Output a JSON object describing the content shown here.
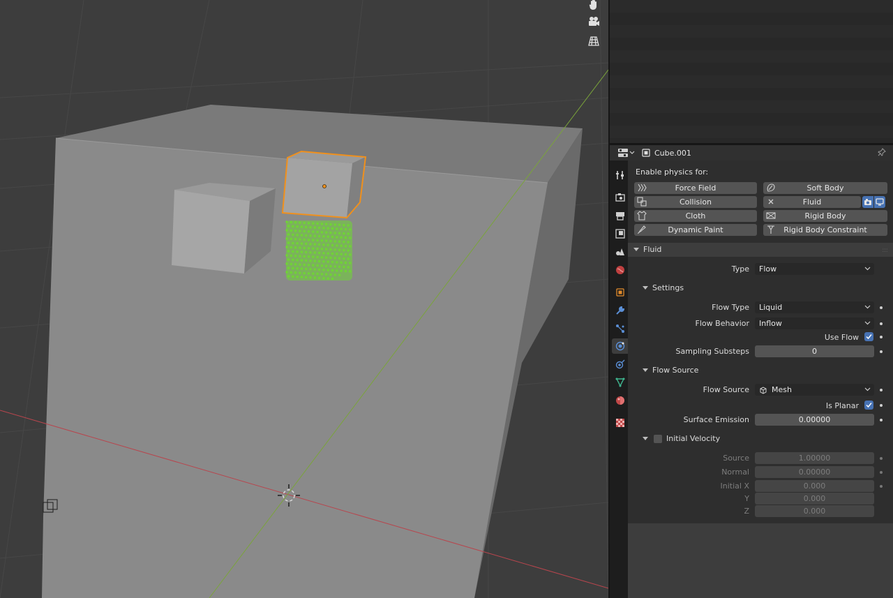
{
  "viewport": {
    "nav_icons": [
      "hand-icon",
      "camera-icon",
      "grid-icon"
    ]
  },
  "properties": {
    "object_name": "Cube.001",
    "enable_physics_label": "Enable physics for:",
    "physics_buttons": [
      {
        "label": "Force Field"
      },
      {
        "label": "Soft Body"
      },
      {
        "label": "Collision"
      },
      {
        "label": "Fluid"
      },
      {
        "label": "Cloth"
      },
      {
        "label": "Rigid Body"
      },
      {
        "label": "Dynamic Paint"
      },
      {
        "label": "Rigid Body Constraint"
      }
    ],
    "fluid": {
      "title": "Fluid",
      "type_label": "Type",
      "type_value": "Flow",
      "settings": {
        "title": "Settings",
        "flow_type_label": "Flow Type",
        "flow_type_value": "Liquid",
        "flow_behavior_label": "Flow Behavior",
        "flow_behavior_value": "Inflow",
        "use_flow_label": "Use Flow",
        "use_flow": true,
        "sampling_substeps_label": "Sampling Substeps",
        "sampling_substeps_value": "0"
      },
      "flow_source": {
        "title": "Flow Source",
        "flow_source_label": "Flow Source",
        "flow_source_value": "Mesh",
        "is_planar_label": "Is Planar",
        "is_planar": true,
        "surface_emission_label": "Surface Emission",
        "surface_emission_value": "0.00000"
      },
      "initial_velocity": {
        "title": "Initial Velocity",
        "enabled": false,
        "source_label": "Source",
        "source_value": "1.00000",
        "normal_label": "Normal",
        "normal_value": "0.00000",
        "initial_x_label": "Initial X",
        "initial_x_value": "0.000",
        "y_label": "Y",
        "y_value": "0.000",
        "z_label": "Z",
        "z_value": "0.000"
      }
    }
  },
  "colors": {
    "selection_outline": "#f0901c",
    "particles": "#6fd534",
    "x_axis": "#b8454d",
    "y_axis": "#7aa43a",
    "checkbox_active": "#4772b3"
  }
}
